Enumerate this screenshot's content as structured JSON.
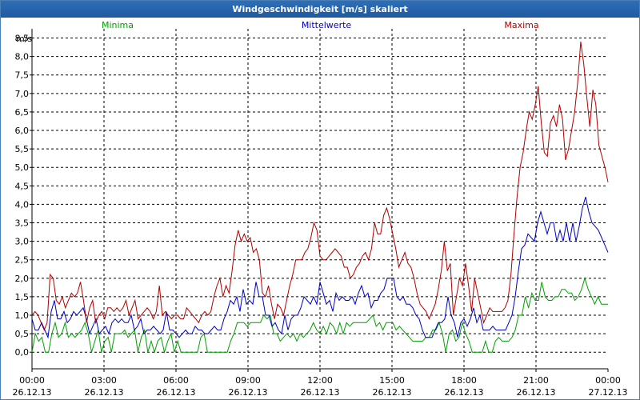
{
  "window": {
    "title": "Windgeschwindigkeit [m/s] skaliert"
  },
  "chart_data": {
    "type": "line",
    "title": "Windgeschwindigkeit [m/s] skaliert",
    "ylabel": "m/s",
    "ylim": [
      -0.45,
      8.75
    ],
    "y_ticks": [
      "0,0",
      "0,5",
      "1,0",
      "1,5",
      "2,0",
      "2,5",
      "3,0",
      "3,5",
      "4,0",
      "4,5",
      "5,0",
      "5,5",
      "6,0",
      "6,5",
      "7,0",
      "7,5",
      "8,0",
      "8,5"
    ],
    "x_ticks": [
      {
        "time": "00:00",
        "date": "26.12.13"
      },
      {
        "time": "03:00",
        "date": "26.12.13"
      },
      {
        "time": "06:00",
        "date": "26.12.13"
      },
      {
        "time": "09:00",
        "date": "26.12.13"
      },
      {
        "time": "12:00",
        "date": "26.12.13"
      },
      {
        "time": "15:00",
        "date": "26.12.13"
      },
      {
        "time": "18:00",
        "date": "26.12.13"
      },
      {
        "time": "21:00",
        "date": "26.12.13"
      },
      {
        "time": "00:00",
        "date": "27.12.13"
      }
    ],
    "grid": true,
    "series": [
      {
        "name": "Minima",
        "color": "#00a000",
        "values": [
          0.0,
          0.5,
          0.3,
          0.4,
          0.0,
          0.0,
          0.5,
          0.8,
          0.4,
          0.5,
          0.8,
          0.4,
          0.5,
          0.4,
          0.5,
          0.6,
          0.8,
          0.5,
          0.0,
          0.3,
          0.6,
          0.0,
          0.3,
          0.4,
          0.0,
          0.5,
          0.5,
          0.5,
          0.6,
          0.4,
          0.5,
          0.6,
          0.0,
          0.4,
          0.6,
          0.0,
          0.3,
          0.0,
          0.3,
          0.4,
          0.0,
          0.3,
          0.5,
          0.0,
          0.3,
          0.0,
          0.0,
          0.0,
          0.0,
          0.0,
          0.0,
          0.4,
          0.5,
          0.0,
          0.0,
          0.0,
          0.0,
          0.0,
          0.0,
          0.0,
          0.3,
          0.5,
          0.8,
          0.8,
          0.8,
          0.7,
          0.8,
          0.8,
          0.8,
          0.8,
          1.0,
          0.9,
          1.0,
          0.5,
          0.5,
          0.3,
          0.4,
          0.5,
          0.4,
          0.5,
          0.3,
          0.5,
          0.4,
          0.5,
          0.6,
          0.8,
          0.6,
          0.5,
          0.7,
          0.5,
          0.8,
          0.7,
          0.5,
          0.8,
          0.5,
          0.8,
          0.7,
          0.8,
          0.8,
          0.8,
          0.8,
          0.8,
          0.9,
          1.0,
          0.7,
          0.8,
          0.6,
          0.8,
          0.8,
          0.8,
          0.6,
          0.7,
          0.6,
          0.5,
          0.4,
          0.3,
          0.3,
          0.3,
          0.3,
          0.4,
          0.4,
          0.6,
          0.6,
          0.8,
          0.5,
          0.0,
          0.5,
          0.6,
          0.3,
          0.4,
          0.8,
          0.5,
          0.3,
          0.0,
          0.0,
          0.0,
          0.0,
          0.3,
          0.0,
          0.0,
          0.3,
          0.4,
          0.3,
          0.3,
          0.3,
          0.4,
          0.6,
          1.0,
          1.0,
          1.5,
          1.2,
          1.6,
          1.4,
          1.4,
          1.9,
          1.5,
          1.4,
          1.4,
          1.5,
          1.5,
          1.7,
          1.7,
          1.6,
          1.6,
          1.4,
          1.5,
          1.7,
          2.0,
          1.7,
          1.5,
          1.3,
          1.5,
          1.3,
          1.3,
          1.3
        ]
      },
      {
        "name": "Mittelwerte",
        "color": "#0000c8",
        "values": [
          0.9,
          0.6,
          0.6,
          0.8,
          0.6,
          0.4,
          1.1,
          1.4,
          0.9,
          0.9,
          1.1,
          0.8,
          0.9,
          1.1,
          1.0,
          1.1,
          1.2,
          0.9,
          0.5,
          0.7,
          0.9,
          0.5,
          0.6,
          0.7,
          0.5,
          0.8,
          0.9,
          0.8,
          0.9,
          0.8,
          0.8,
          1.0,
          0.6,
          0.7,
          0.9,
          0.5,
          0.6,
          0.6,
          0.7,
          0.6,
          0.5,
          0.6,
          1.1,
          0.6,
          0.6,
          0.5,
          0.4,
          0.5,
          0.6,
          0.5,
          0.5,
          0.7,
          0.6,
          0.6,
          0.5,
          0.5,
          0.6,
          0.7,
          0.6,
          0.6,
          0.9,
          1.1,
          1.4,
          1.3,
          1.5,
          1.1,
          1.7,
          1.3,
          1.4,
          1.3,
          1.9,
          1.5,
          1.5,
          1.0,
          1.0,
          0.7,
          0.8,
          0.6,
          0.5,
          1.0,
          0.6,
          0.9,
          1.0,
          1.0,
          1.2,
          1.5,
          1.4,
          1.3,
          1.5,
          1.3,
          1.9,
          1.6,
          1.3,
          1.4,
          1.1,
          1.6,
          1.4,
          1.5,
          1.4,
          1.4,
          1.5,
          1.3,
          1.6,
          1.8,
          1.5,
          1.6,
          1.2,
          1.4,
          1.4,
          1.6,
          1.7,
          2.0,
          2.0,
          2.0,
          1.5,
          1.4,
          1.5,
          1.3,
          1.3,
          1.2,
          1.0,
          0.9,
          0.6,
          0.4,
          0.4,
          0.4,
          0.6,
          0.8,
          0.8,
          0.9,
          1.5,
          1.0,
          0.8,
          0.4,
          0.8,
          0.9,
          0.7,
          0.9,
          1.2,
          0.8,
          1.0,
          0.6,
          0.6,
          0.6,
          0.7,
          0.6,
          0.6,
          0.6,
          0.6,
          0.8,
          1.0,
          1.5,
          2.2,
          2.8,
          2.9,
          3.2,
          3.1,
          3.0,
          3.5,
          3.8,
          3.5,
          3.2,
          3.5,
          3.5,
          3.0,
          3.3,
          3.0,
          3.5,
          3.0,
          3.5,
          3.0,
          3.4,
          3.9,
          4.2,
          3.8,
          3.5,
          3.4,
          3.3,
          3.1,
          2.9,
          2.7
        ]
      },
      {
        "name": "Maxima",
        "color": "#b00000",
        "values": [
          1.0,
          1.1,
          1.0,
          0.8,
          0.6,
          0.8,
          2.1,
          2.0,
          1.4,
          1.3,
          1.5,
          1.2,
          1.4,
          1.6,
          1.5,
          1.6,
          1.9,
          1.4,
          0.8,
          1.2,
          1.4,
          0.8,
          1.0,
          1.1,
          0.9,
          1.2,
          1.2,
          1.1,
          1.2,
          1.1,
          1.2,
          1.4,
          1.0,
          1.2,
          1.4,
          0.9,
          1.0,
          1.1,
          1.2,
          1.1,
          0.9,
          1.1,
          1.8,
          1.0,
          1.1,
          1.0,
          0.9,
          1.0,
          1.0,
          0.9,
          0.9,
          1.2,
          1.1,
          1.0,
          0.9,
          0.8,
          1.0,
          1.1,
          1.0,
          1.1,
          1.5,
          1.8,
          2.0,
          1.5,
          1.8,
          1.6,
          2.2,
          2.9,
          3.3,
          3.0,
          3.2,
          3.0,
          3.1,
          2.7,
          2.8,
          2.5,
          1.6,
          1.5,
          1.8,
          1.3,
          0.9,
          1.3,
          1.2,
          1.0,
          1.4,
          1.8,
          2.1,
          2.5,
          2.5,
          2.5,
          2.7,
          2.8,
          3.1,
          3.5,
          3.3,
          2.6,
          2.5,
          2.5,
          2.6,
          2.7,
          2.8,
          2.7,
          2.6,
          2.3,
          2.3,
          2.0,
          2.1,
          2.3,
          2.4,
          2.6,
          2.7,
          2.5,
          2.8,
          3.5,
          3.2,
          3.2,
          3.7,
          3.9,
          3.6,
          3.2,
          2.8,
          2.3,
          2.5,
          2.7,
          2.4,
          2.3,
          2.0,
          1.6,
          1.3,
          1.2,
          1.1,
          0.9,
          1.1,
          1.3,
          1.7,
          2.2,
          3.0,
          2.2,
          2.4,
          1.0,
          1.5,
          2.0,
          1.8,
          2.4,
          1.8,
          1.1,
          2.0,
          1.6,
          1.2,
          0.8,
          1.0,
          1.2,
          1.1,
          1.1,
          1.1,
          1.1,
          1.2,
          1.4,
          2.1,
          3.2,
          4.2,
          5.0,
          5.4,
          6.0,
          6.5,
          6.3,
          6.7,
          7.2,
          6.2,
          5.4,
          5.3,
          6.2,
          6.4,
          6.1,
          6.7,
          6.3,
          5.2,
          5.5,
          6.0,
          6.5,
          7.3,
          8.4,
          7.8,
          6.9,
          6.1,
          7.1,
          6.7,
          5.6,
          5.3,
          5.0,
          4.6
        ]
      }
    ]
  }
}
